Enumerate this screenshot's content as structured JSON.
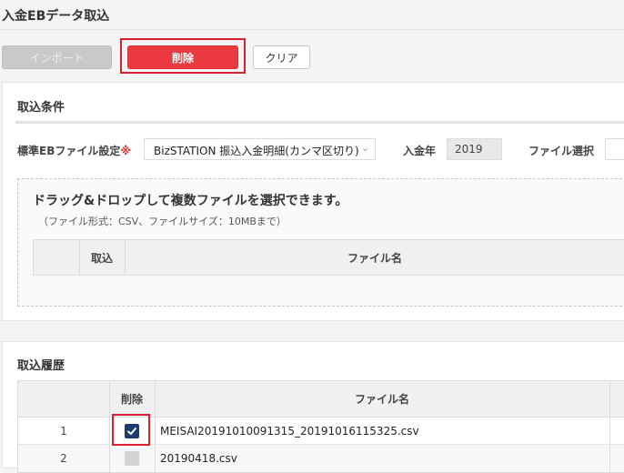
{
  "page": {
    "title": "入金EBデータ取込"
  },
  "toolbar": {
    "import_label": "インポート",
    "delete_label": "削除",
    "clear_label": "クリア"
  },
  "conditions": {
    "heading": "取込条件",
    "eb_setting_label": "標準EBファイル設定",
    "required_mark": "※",
    "eb_setting_value": "BizSTATION 振込入金明細(カンマ区切り)",
    "year_label": "入金年",
    "year_value": "2019",
    "file_select_label": "ファイル選択"
  },
  "dropzone": {
    "main_text": "ドラッグ&ドロップして複数ファイルを選択できます。",
    "sub_text": "（ファイル形式：CSV、ファイルサイズ：10MBまで）",
    "columns": {
      "import": "取込",
      "filename": "ファイル名"
    }
  },
  "history": {
    "heading": "取込履歴",
    "columns": {
      "delete": "削除",
      "filename": "ファイル名"
    },
    "rows": [
      {
        "no": "1",
        "checked": true,
        "filename": "MEISAI20191010091315_20191016115325.csv"
      },
      {
        "no": "2",
        "checked": false,
        "filename": "20190418.csv"
      }
    ]
  },
  "colors": {
    "accent_red": "#ea3a3f",
    "highlight": "#d8212e",
    "checkbox_navy": "#1e3b6e"
  }
}
